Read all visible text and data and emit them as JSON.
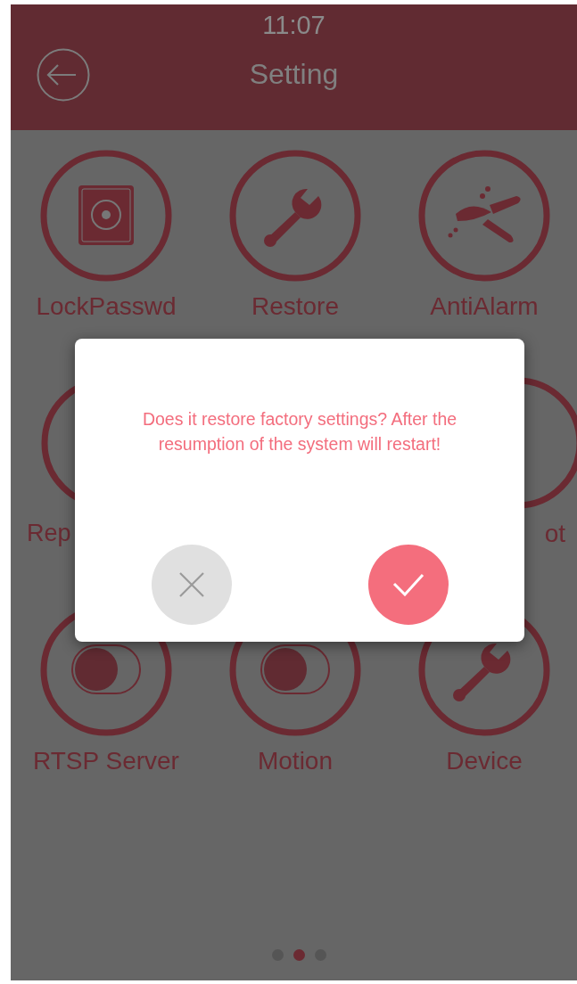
{
  "status_bar": {
    "time": "11:07"
  },
  "header": {
    "title": "Setting"
  },
  "items": [
    {
      "label": "LockPasswd",
      "kind": "safe"
    },
    {
      "label": "Restore",
      "kind": "wrench"
    },
    {
      "label": "AntiAlarm",
      "kind": "pliers"
    },
    {
      "label": "Rep",
      "kind": "partial-left"
    },
    {
      "kind": "hidden"
    },
    {
      "label": "ot",
      "kind": "partial-right"
    },
    {
      "label": "RTSP Server",
      "kind": "toggle"
    },
    {
      "label": "Motion",
      "kind": "toggle"
    },
    {
      "label": "Device",
      "kind": "wrench"
    }
  ],
  "pager": [
    {
      "selected": false
    },
    {
      "selected": true
    },
    {
      "selected": false
    }
  ],
  "dialog": {
    "message": "Does it restore factory settings? After the resumption of the system will restart!"
  }
}
